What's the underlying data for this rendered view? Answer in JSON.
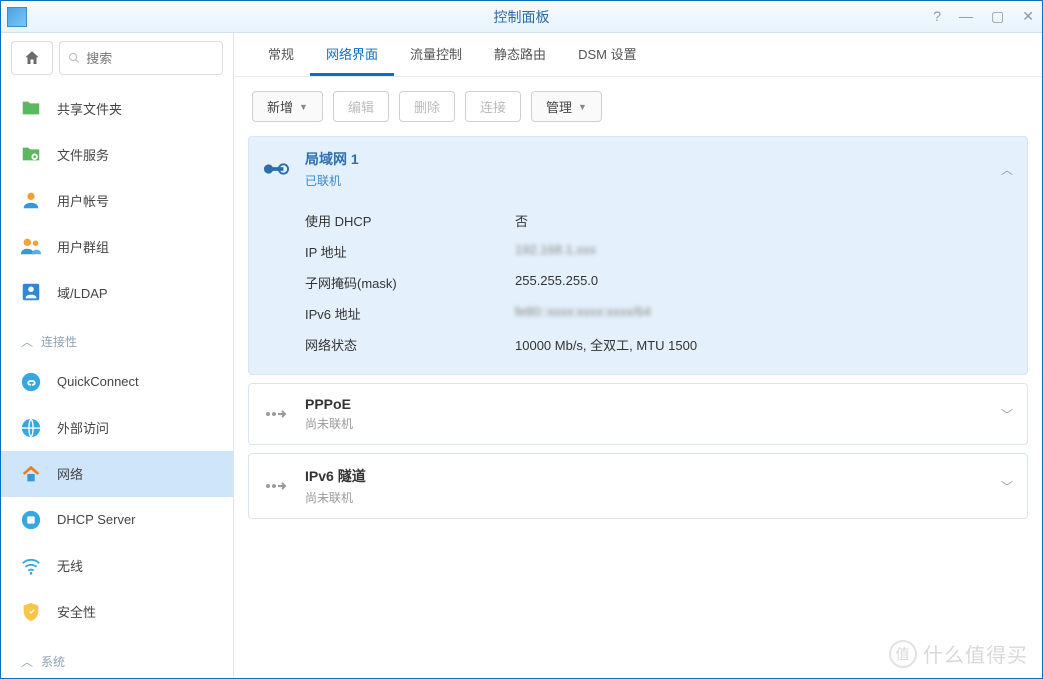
{
  "window": {
    "title": "控制面板"
  },
  "search": {
    "placeholder": "搜索"
  },
  "sidebar_sections": {
    "connectivity": "连接性",
    "system": "系统"
  },
  "sidebar": {
    "items": [
      {
        "label": "共享文件夹"
      },
      {
        "label": "文件服务"
      },
      {
        "label": "用户帐号"
      },
      {
        "label": "用户群组"
      },
      {
        "label": "域/LDAP"
      }
    ],
    "conn_items": [
      {
        "label": "QuickConnect"
      },
      {
        "label": "外部访问"
      },
      {
        "label": "网络"
      },
      {
        "label": "DHCP Server"
      },
      {
        "label": "无线"
      },
      {
        "label": "安全性"
      }
    ]
  },
  "tabs": [
    {
      "label": "常规"
    },
    {
      "label": "网络界面"
    },
    {
      "label": "流量控制"
    },
    {
      "label": "静态路由"
    },
    {
      "label": "DSM 设置"
    }
  ],
  "toolbar": {
    "add": "新增",
    "edit": "编辑",
    "delete": "删除",
    "connect": "连接",
    "manage": "管理"
  },
  "interfaces": [
    {
      "title": "局域网 1",
      "status": "已联机",
      "rows": [
        {
          "k": "使用 DHCP",
          "v": "否"
        },
        {
          "k": "IP 地址",
          "v": "192.168.1.xxx"
        },
        {
          "k": "子网掩码(mask)",
          "v": "255.255.255.0"
        },
        {
          "k": "IPv6 地址",
          "v": "fe80::xxxx:xxxx:xxxx/64"
        },
        {
          "k": "网络状态",
          "v": "10000 Mb/s, 全双工, MTU 1500"
        }
      ]
    },
    {
      "title": "PPPoE",
      "status": "尚未联机"
    },
    {
      "title": "IPv6 隧道",
      "status": "尚未联机"
    }
  ],
  "watermark": "什么值得买"
}
